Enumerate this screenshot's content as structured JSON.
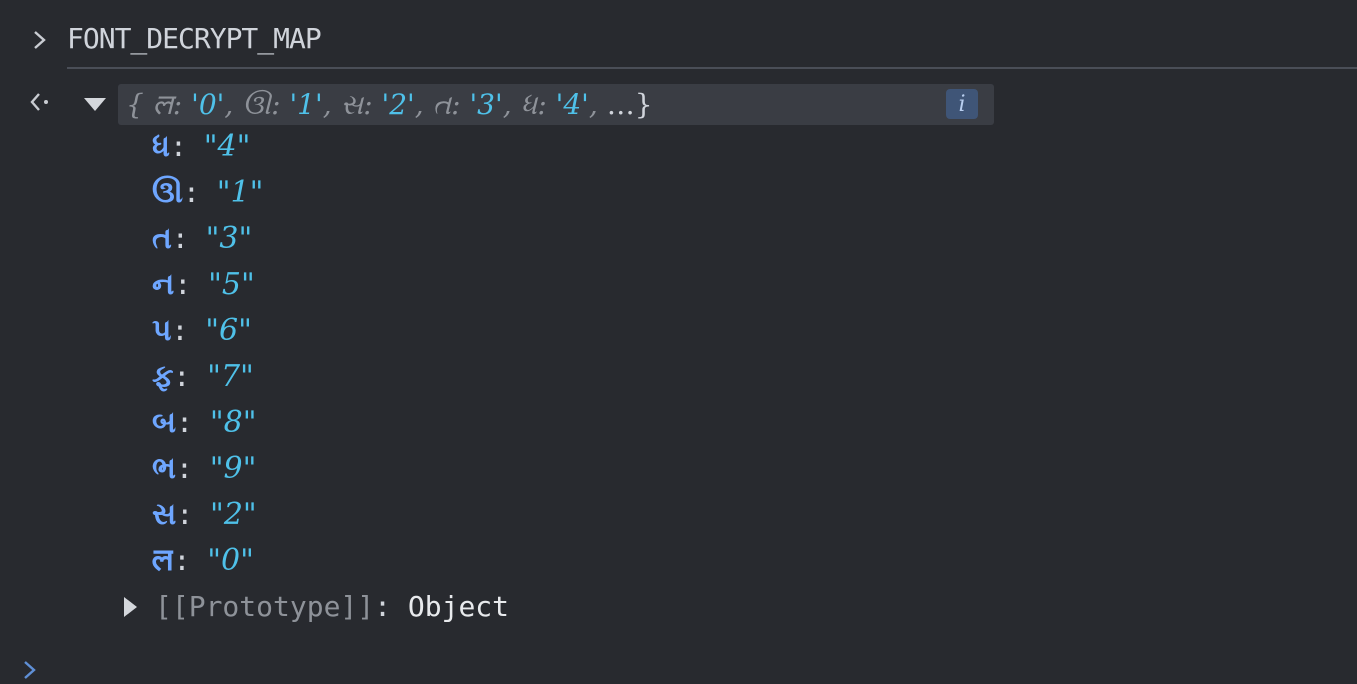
{
  "console": {
    "input": {
      "expression": "FONT_DECRYPT_MAP"
    },
    "result": {
      "summary_prefix": "{",
      "summary_items": [
        {
          "key": "𑆬",
          "sep": ": ",
          "value": "'0'"
        },
        {
          "key": "ઊ",
          "sep": ": ",
          "value": "'1'"
        },
        {
          "key": "સ",
          "sep": ": ",
          "value": "'2'"
        },
        {
          "key": "ત",
          "sep": ": ",
          "value": "'3'"
        },
        {
          "key": "ધ",
          "sep": ": ",
          "value": "'4'"
        }
      ],
      "summary_ellipsis": "…}",
      "info_badge": "i",
      "properties": [
        {
          "key": "ધ",
          "colon": ": ",
          "value": "\"4\""
        },
        {
          "key": "ઊ",
          "colon": ": ",
          "value": "\"1\""
        },
        {
          "key": "ત",
          "colon": ": ",
          "value": "\"3\""
        },
        {
          "key": "ન",
          "colon": ": ",
          "value": "\"5\""
        },
        {
          "key": "પ",
          "colon": ": ",
          "value": "\"6\""
        },
        {
          "key": "ફ",
          "colon": ": ",
          "value": "\"7\""
        },
        {
          "key": "બ",
          "colon": ": ",
          "value": "\"8\""
        },
        {
          "key": "ભ",
          "colon": ": ",
          "value": "\"9\""
        },
        {
          "key": "સ",
          "colon": ": ",
          "value": "\"2\""
        },
        {
          "key": "𑆬",
          "colon": ": ",
          "value": "\"0\""
        }
      ],
      "prototype": {
        "key": "[[Prototype]]",
        "colon": ": ",
        "value": "Object"
      }
    },
    "icons": {
      "input_prompt": "chevron-right-icon",
      "result_prompt": "return-arrow-icon",
      "expand": "triangle-down-icon",
      "collapse": "triangle-right-icon",
      "bottom_prompt": "chevron-right-icon"
    },
    "colors": {
      "background": "#282a2f",
      "key": "#6ea6ff",
      "string_value": "#4fc1e9",
      "muted": "#8e9299",
      "text": "#d0d4db"
    }
  }
}
